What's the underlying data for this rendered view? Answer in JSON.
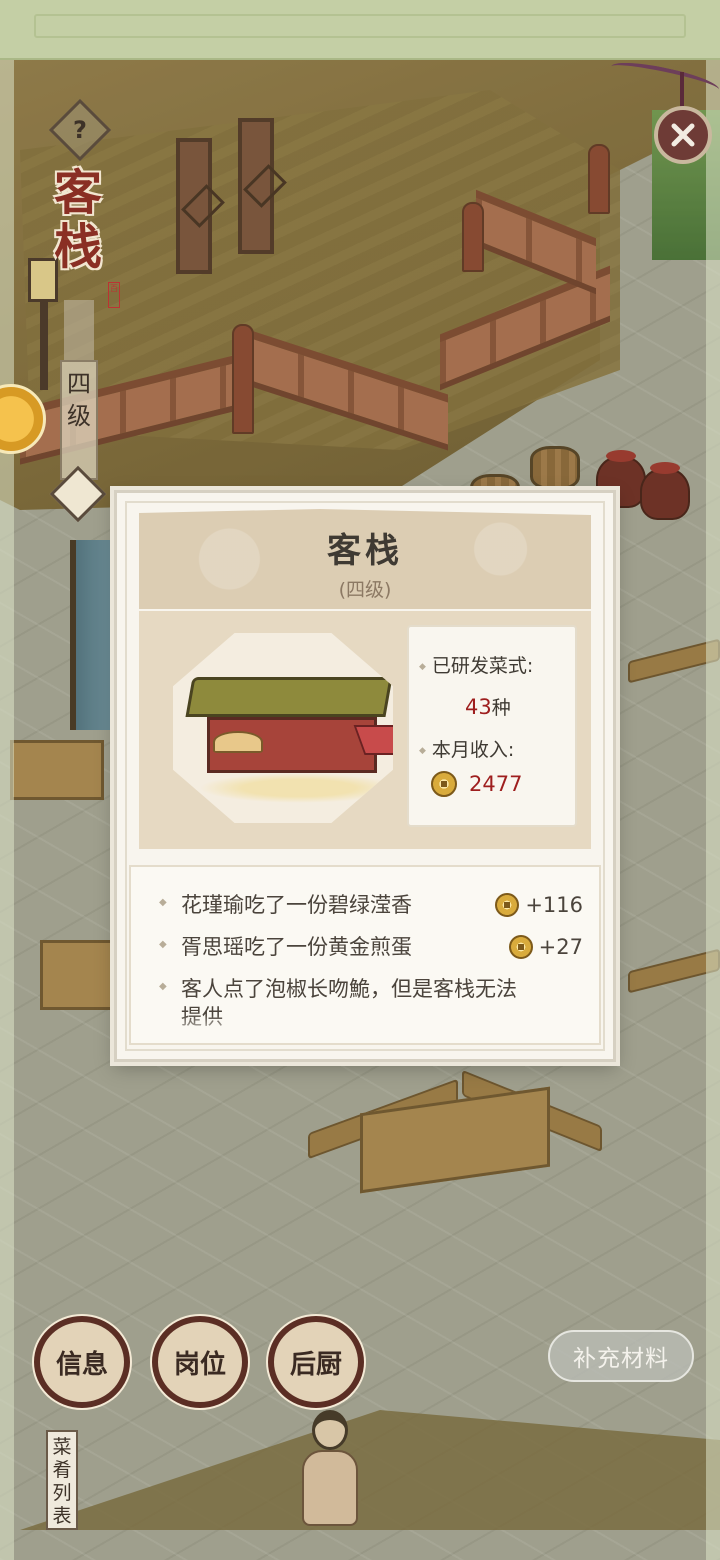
{
  "building": {
    "title": "客栈",
    "level_vertical": [
      "四",
      "级"
    ],
    "seal": "百"
  },
  "icons": {
    "help": "question-mark-icon",
    "close": "close-icon",
    "coin": "copper-coin-icon"
  },
  "help_symbol": "?",
  "panel": {
    "title": "客栈",
    "level": "(四级)",
    "stats": {
      "dishes_label": "已研发菜式:",
      "dishes_value": "43",
      "dishes_unit": "种",
      "income_label": "本月收入:",
      "income_value": "2477"
    },
    "log": [
      {
        "text": "花瑾瑜吃了一份碧绿滢香",
        "gain": "+116"
      },
      {
        "text": "胥思瑶吃了一份黄金煎蛋",
        "gain": "+27"
      },
      {
        "text": "客人点了泡椒长吻鮠，但是客栈无法",
        "gain": ""
      },
      {
        "text": "提供",
        "gain": ""
      }
    ]
  },
  "buttons": {
    "info": "信息",
    "posts": "岗位",
    "kitchen": "后厨",
    "refill": "补充材料"
  },
  "menu_tab": [
    "菜",
    "肴",
    "列",
    "表"
  ],
  "colors": {
    "title_red": "#8a2f24",
    "value_red": "#9e1e1e",
    "panel_bg": "#f8f5ee",
    "button_ring": "#5b2e24"
  }
}
